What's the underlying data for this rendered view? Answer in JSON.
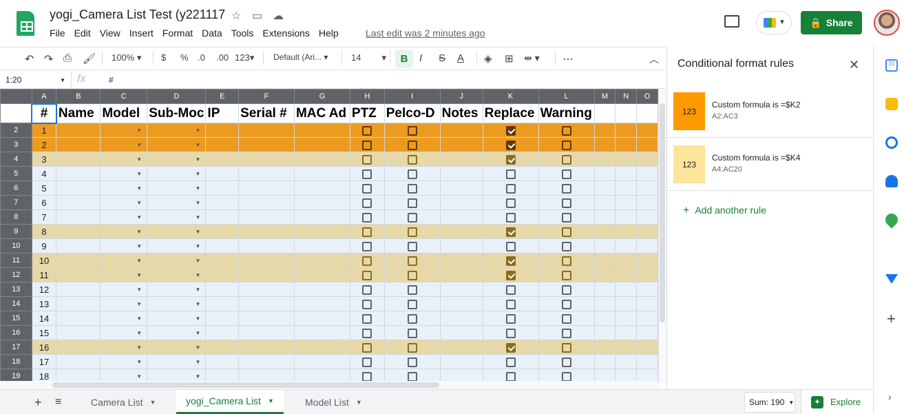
{
  "app": {
    "title": "yogi_Camera List Test (y221117",
    "last_edit": "Last edit was 2 minutes ago",
    "share_label": "Share"
  },
  "menu": [
    "File",
    "Edit",
    "View",
    "Insert",
    "Format",
    "Data",
    "Tools",
    "Extensions",
    "Help"
  ],
  "toolbar": {
    "zoom": "100%",
    "currency": "$",
    "percent": "%",
    "dec_less": ".0",
    "dec_more": ".00",
    "number_format": "123",
    "font": "Default (Ari...",
    "font_size": "14",
    "bold": "B",
    "italic": "I",
    "strike": "S",
    "text_color": "A",
    "more": "⋯"
  },
  "formula_bar": {
    "namebox": "1:20",
    "fx": "fx",
    "value": "#"
  },
  "columns": [
    "A",
    "B",
    "C",
    "D",
    "E",
    "F",
    "G",
    "H",
    "I",
    "J",
    "K",
    "L",
    "M",
    "N",
    "O"
  ],
  "header_row": [
    "#",
    "Name",
    "Model",
    "Sub-Moc",
    "IP",
    "Serial #",
    "MAC Ad",
    "PTZ",
    "Pelco-D",
    "Notes",
    "Replace",
    "Warning",
    "",
    "",
    ""
  ],
  "rows": [
    {
      "rownum": "2",
      "n": "1",
      "style": "or",
      "replace": true
    },
    {
      "rownum": "3",
      "n": "2",
      "style": "or",
      "replace": true
    },
    {
      "rownum": "4",
      "n": "3",
      "style": "lt",
      "replace": true
    },
    {
      "rownum": "5",
      "n": "4",
      "style": "bl",
      "replace": false
    },
    {
      "rownum": "6",
      "n": "5",
      "style": "bl",
      "replace": false
    },
    {
      "rownum": "7",
      "n": "6",
      "style": "bl",
      "replace": false
    },
    {
      "rownum": "8",
      "n": "7",
      "style": "bl",
      "replace": false
    },
    {
      "rownum": "9",
      "n": "8",
      "style": "lt",
      "replace": true
    },
    {
      "rownum": "10",
      "n": "9",
      "style": "bl",
      "replace": false
    },
    {
      "rownum": "11",
      "n": "10",
      "style": "lt",
      "replace": true
    },
    {
      "rownum": "12",
      "n": "11",
      "style": "lt",
      "replace": true
    },
    {
      "rownum": "13",
      "n": "12",
      "style": "bl",
      "replace": false
    },
    {
      "rownum": "14",
      "n": "13",
      "style": "bl",
      "replace": false
    },
    {
      "rownum": "15",
      "n": "14",
      "style": "bl",
      "replace": false
    },
    {
      "rownum": "16",
      "n": "15",
      "style": "bl",
      "replace": false
    },
    {
      "rownum": "17",
      "n": "16",
      "style": "lt",
      "replace": true
    },
    {
      "rownum": "18",
      "n": "17",
      "style": "bl",
      "replace": false
    },
    {
      "rownum": "19",
      "n": "18",
      "style": "bl",
      "replace": false
    }
  ],
  "sheet_tabs": [
    "Camera List",
    "yogi_Camera List",
    "Model List"
  ],
  "active_tab": "yogi_Camera List",
  "sum": "Sum: 190",
  "explore": "Explore",
  "panel": {
    "title": "Conditional format rules",
    "rules": [
      {
        "sample": "123",
        "formula": "Custom formula is =$K2",
        "range": "A2:AC3",
        "color": "#ff9900"
      },
      {
        "sample": "123",
        "formula": "Custom formula is =$K4",
        "range": "A4:AC20",
        "color": "#ffe599"
      }
    ],
    "add_rule": "Add another rule"
  },
  "colors": {
    "accent": "#188038",
    "orange_row": "#ec9b20",
    "light_row": "#e6d8a8",
    "blue_row": "#e8f0fa"
  }
}
